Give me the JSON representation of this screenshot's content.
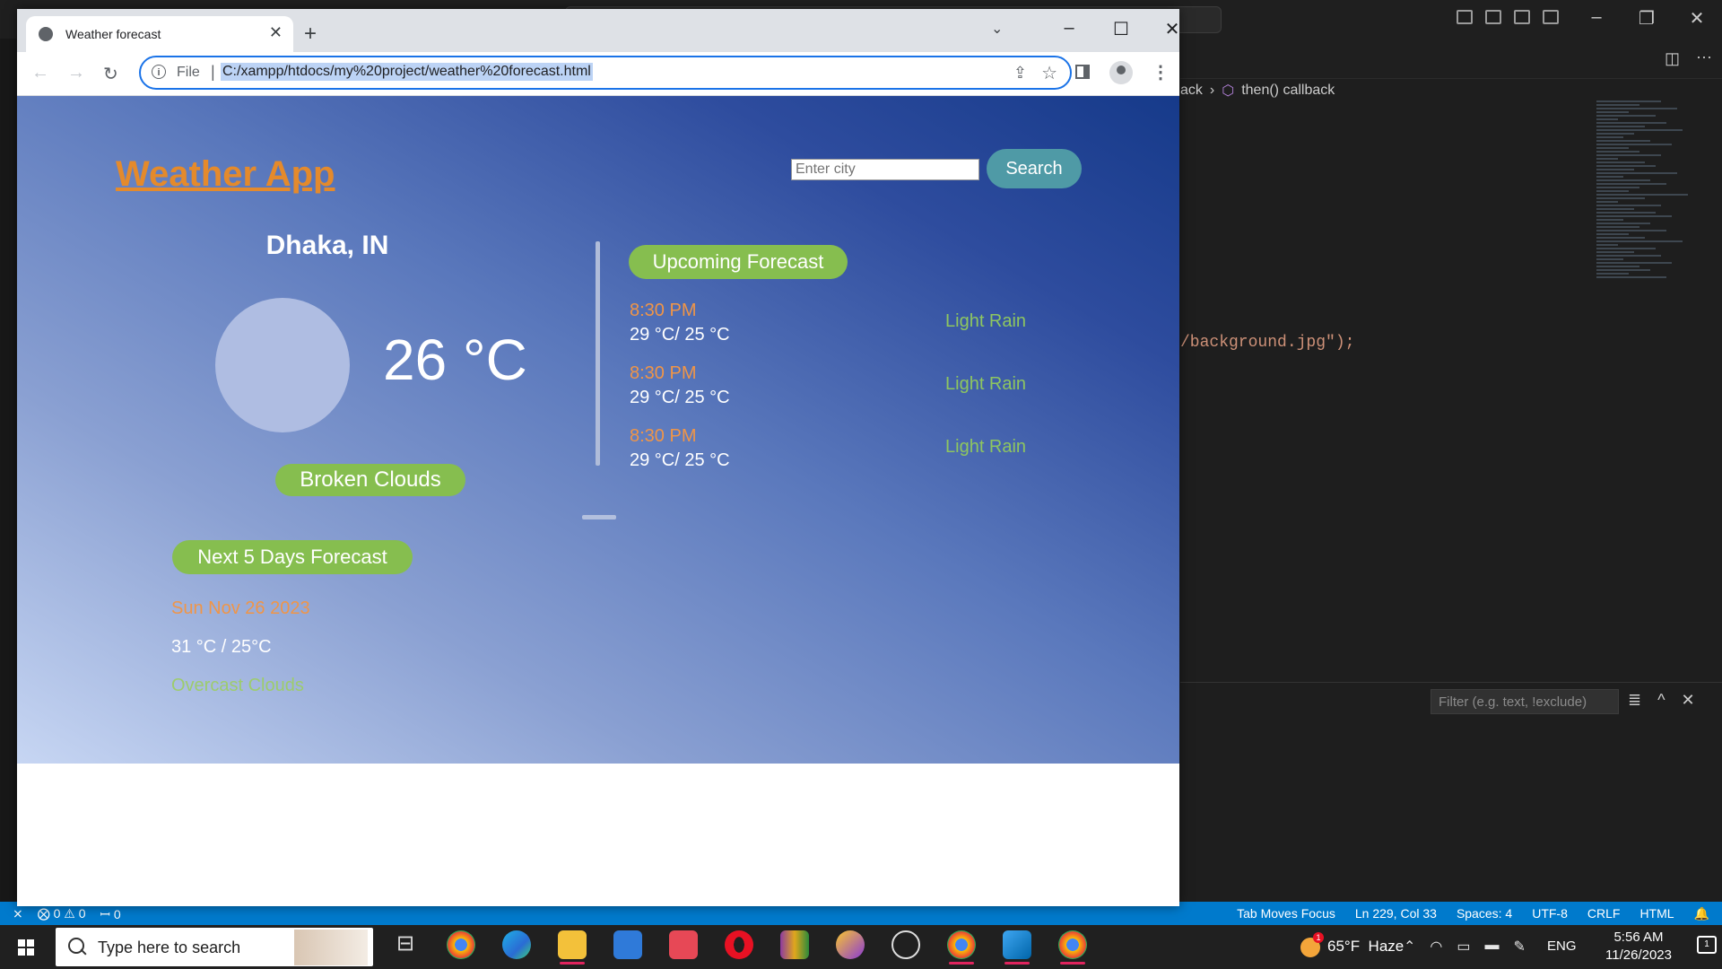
{
  "vscode": {
    "breadcrumb": [
      "ack",
      "then() callback"
    ],
    "code_line": "/background.jpg\");",
    "filter_placeholder": "Filter (e.g. text, !exclude)",
    "status_left": [
      "⨂ 0 ⚠ 0",
      "ꟷ 0"
    ],
    "status_right": [
      "Tab Moves Focus",
      "Ln 229, Col 33",
      "Spaces: 4",
      "UTF-8",
      "CRLF",
      "HTML"
    ]
  },
  "browser": {
    "tab_title": "Weather forecast",
    "scheme_label": "File",
    "url": "C:/xampp/htdocs/my%20project/weather%20forecast.html"
  },
  "weather": {
    "app_title": "Weather App",
    "search_placeholder": "Enter city",
    "search_button": "Search",
    "city": "Dhaka, IN",
    "temperature": "26 °C",
    "condition": "Broken Clouds",
    "upcoming_title": "Upcoming Forecast",
    "upcoming": [
      {
        "time": "8:30 PM",
        "temps": "29 °C/ 25 °C",
        "desc": "Light Rain"
      },
      {
        "time": "8:30 PM",
        "temps": "29 °C/ 25 °C",
        "desc": "Light Rain"
      },
      {
        "time": "8:30 PM",
        "temps": "29 °C/ 25 °C",
        "desc": "Light Rain"
      }
    ],
    "next_days_title": "Next 5 Days Forecast",
    "days": [
      {
        "date": "Sun Nov 26 2023",
        "temps": "31 °C / 25°C",
        "desc": "Overcast Clouds"
      }
    ]
  },
  "taskbar": {
    "search_placeholder": "Type here to search",
    "weather_temp": "65°F",
    "weather_desc": "Haze",
    "weather_badge": "1",
    "language": "ENG",
    "time": "5:56 AM",
    "date": "11/26/2023",
    "notification_count": "1",
    "apps": [
      "chrome-icon",
      "edge-icon",
      "file-explorer-icon",
      "store-icon",
      "gift-icon",
      "opera-icon",
      "winrar-icon",
      "vpn-icon",
      "chatgpt-icon",
      "chrome-profile-icon",
      "vscode-icon",
      "chrome-active-icon"
    ]
  },
  "colors": {
    "app_title": "#e48a2c",
    "pill_green": "#86be4f",
    "search_button": "#4f9aa6",
    "forecast_time": "#f09547",
    "forecast_desc": "#8ec660",
    "vscode_status": "#007acc"
  }
}
